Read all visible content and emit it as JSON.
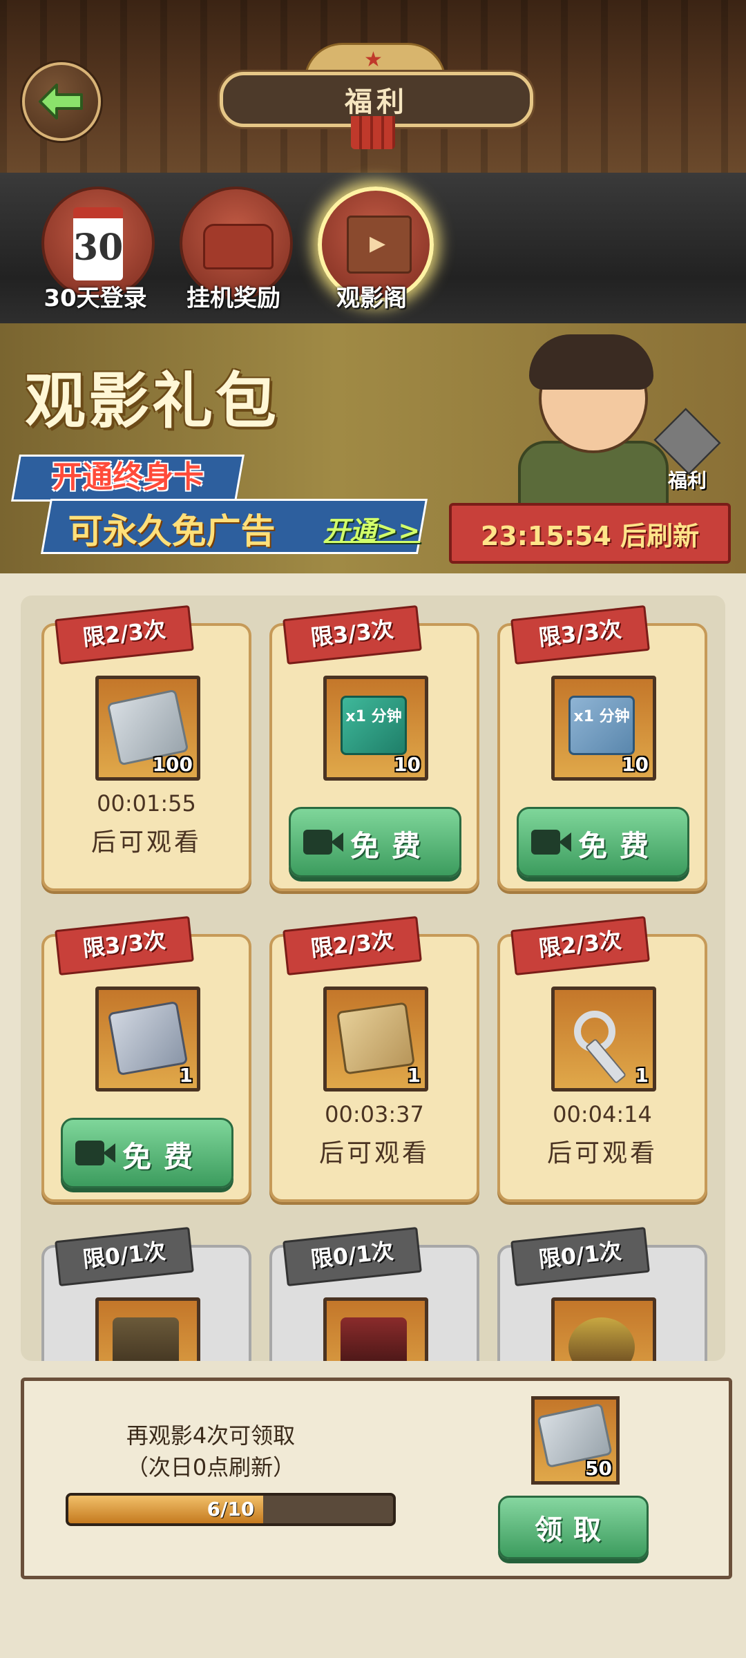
{
  "header": {
    "title": "福利"
  },
  "categories": [
    {
      "label": "30天登录",
      "icon": "calendar-icon",
      "icon_text": "30",
      "active": false
    },
    {
      "label": "挂机奖励",
      "icon": "armchair-icon",
      "active": false
    },
    {
      "label": "观影阁",
      "icon": "clapperboard-icon",
      "active": true
    }
  ],
  "banner": {
    "title": "观影礼包",
    "promo_line1": "开通终身卡",
    "promo_line2": "可永久免广告",
    "promo_action": "开通>>",
    "gift_label": "福利",
    "refresh_text": "23:15:54 后刷新"
  },
  "cards": [
    {
      "limit": "限2/3次",
      "item": "cash-bundle-icon",
      "count": "100",
      "state": "timer",
      "timer": "00:01:55",
      "after": "后可观看"
    },
    {
      "limit": "限3/3次",
      "item": "silver-minute-ticket-icon",
      "item_text": "x1 分钟",
      "count": "10",
      "state": "free",
      "button": "免费"
    },
    {
      "limit": "限3/3次",
      "item": "blue-minute-ticket-icon",
      "item_text": "x1 分钟",
      "count": "10",
      "state": "free",
      "button": "免费"
    },
    {
      "limit": "限3/3次",
      "item": "id-card-icon",
      "count": "1",
      "state": "free",
      "button": "免费"
    },
    {
      "limit": "限2/3次",
      "item": "map-icon",
      "count": "1",
      "state": "timer",
      "timer": "00:03:37",
      "after": "后可观看"
    },
    {
      "limit": "限2/3次",
      "item": "key-icon",
      "count": "1",
      "state": "timer",
      "timer": "00:04:14",
      "after": "后可观看"
    },
    {
      "limit": "限0/1次",
      "item": "locked-item-icon",
      "state": "done"
    },
    {
      "limit": "限0/1次",
      "item": "lipstick-icon",
      "state": "done"
    },
    {
      "limit": "限0/1次",
      "item": "food-icon",
      "state": "done"
    }
  ],
  "bottom": {
    "message_line1": "再观影4次可领取",
    "message_line2": "（次日0点刷新）",
    "progress_text": "6/10",
    "progress_value": 0.6,
    "reward_item": "cash-bundle-icon",
    "reward_count": "50",
    "claim_label": "领取"
  },
  "colors": {
    "accent_green": "#3c9c5e",
    "tag_red": "#c8403a",
    "card_bg": "#f5e4b5"
  }
}
